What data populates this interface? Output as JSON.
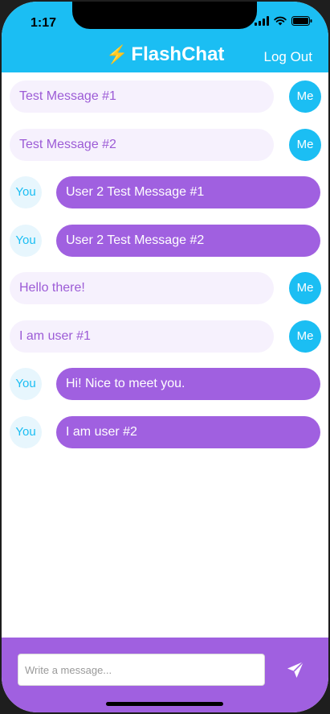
{
  "status_bar": {
    "time": "1:17"
  },
  "header": {
    "title": "FlashChat",
    "title_icon": "lightning-bolt-icon",
    "logout_label": "Log Out"
  },
  "messages": [
    {
      "sender": "me",
      "avatar_label": "Me",
      "text": "Test Message #1"
    },
    {
      "sender": "me",
      "avatar_label": "Me",
      "text": "Test Message #2"
    },
    {
      "sender": "you",
      "avatar_label": "You",
      "text": "User 2 Test Message #1"
    },
    {
      "sender": "you",
      "avatar_label": "You",
      "text": "User 2 Test Message #2"
    },
    {
      "sender": "me",
      "avatar_label": "Me",
      "text": "Hello there!"
    },
    {
      "sender": "me",
      "avatar_label": "Me",
      "text": "I am user #1"
    },
    {
      "sender": "you",
      "avatar_label": "You",
      "text": "Hi! Nice to meet you."
    },
    {
      "sender": "you",
      "avatar_label": "You",
      "text": "I am user #2"
    }
  ],
  "composer": {
    "placeholder": "Write a message...",
    "value": "",
    "send_icon": "send-icon"
  },
  "colors": {
    "primary_blue": "#1bbef3",
    "primary_purple": "#a060e0",
    "light_purple": "#f6f1fd",
    "light_blue": "#e7f6fd"
  }
}
